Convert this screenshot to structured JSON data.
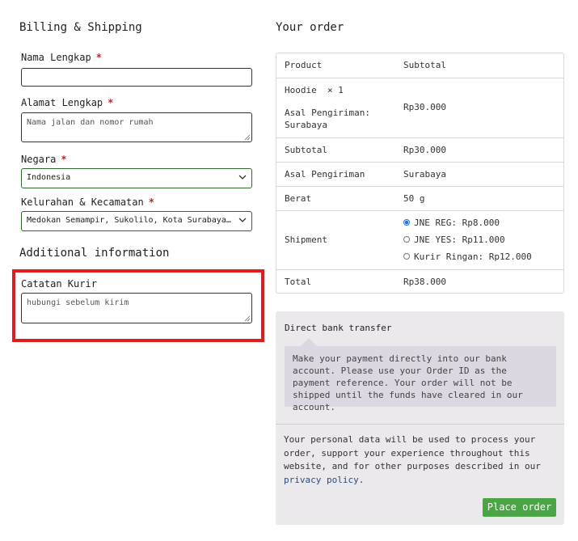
{
  "billing": {
    "heading": "Billing & Shipping",
    "nama": {
      "label": "Nama Lengkap",
      "required": "*",
      "value": ""
    },
    "alamat": {
      "label": "Alamat Lengkap",
      "required": "*",
      "placeholder": "Nama jalan dan nomor rumah"
    },
    "negara": {
      "label": "Negara",
      "required": "*",
      "value": "Indonesia"
    },
    "kelurahan": {
      "label": "Kelurahan & Kecamatan",
      "required": "*",
      "value": "Medokan Semampir, Sukolilo, Kota Surabaya, Jawa Timur"
    }
  },
  "additional": {
    "heading": "Additional information",
    "catatan": {
      "label": "Catatan Kurir",
      "placeholder": "hubungi sebelum kirim"
    }
  },
  "order": {
    "heading": "Your order",
    "col_product": "Product",
    "col_subtotal": "Subtotal",
    "item": {
      "name": "Hoodie",
      "qty": "× 1",
      "meta_label": "Asal Pengiriman:",
      "meta_value": "Surabaya",
      "price": "Rp30.000"
    },
    "subtotal": {
      "label": "Subtotal",
      "value": "Rp30.000"
    },
    "origin": {
      "label": "Asal Pengiriman",
      "value": "Surabaya"
    },
    "weight": {
      "label": "Berat",
      "value": "50 g"
    },
    "shipment": {
      "label": "Shipment",
      "options": [
        {
          "label": "JNE REG: Rp8.000",
          "selected": true
        },
        {
          "label": "JNE YES: Rp11.000",
          "selected": false
        },
        {
          "label": "Kurir Ringan: Rp12.000",
          "selected": false
        }
      ]
    },
    "total": {
      "label": "Total",
      "value": "Rp38.000"
    }
  },
  "payment": {
    "method": "Direct bank transfer",
    "description": "Make your payment directly into our bank account. Please use your Order ID as the payment reference. Your order will not be shipped until the funds have cleared in our account.",
    "privacy_text": "Your personal data will be used to process your order, support your experience throughout this website, and for other purposes described in our",
    "privacy_link": "privacy policy",
    "privacy_end": ".",
    "place_order": "Place order"
  },
  "colors": {
    "accent_button": "#4aa544",
    "highlight": "#e01c1c",
    "required": "#c0262d"
  }
}
